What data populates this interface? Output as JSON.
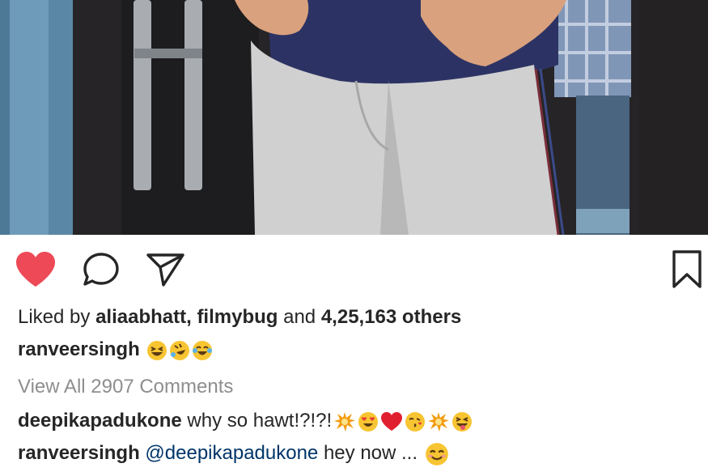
{
  "post": {
    "likes": {
      "prefix": "Liked by",
      "user1": "aliaabhatt,",
      "user2": "filmybug",
      "joiner": "and",
      "count_text": "4,25,163 others"
    },
    "caption": {
      "username": "ranveersingh",
      "emojis": [
        "grinning-squinting-face",
        "rolling-on-floor-laughing",
        "face-with-tears-of-joy"
      ]
    },
    "view_all_comments": "View All 2907 Comments",
    "comments": [
      {
        "username": "deepikapadukone",
        "text": "why so hawt!?!?!",
        "emojis": [
          "collision",
          "smiling-face-with-heart-eyes",
          "red-heart",
          "face-blowing-kiss",
          "collision",
          "squinting-face-with-tongue"
        ]
      },
      {
        "username": "ranveersingh",
        "mention": "@deepikapadukone",
        "text": "hey now ...",
        "emojis": [
          "smiling-face-with-smiling-eyes"
        ]
      }
    ],
    "icons": {
      "like": "heart-icon",
      "comment": "speech-bubble-icon",
      "share": "paper-plane-icon",
      "save": "bookmark-icon"
    },
    "colors": {
      "liked_heart": "#ed4956",
      "text": "#262626",
      "muted": "#8e8e8e",
      "mention": "#003569"
    },
    "photo": {
      "description_icon": "photo-image"
    }
  }
}
